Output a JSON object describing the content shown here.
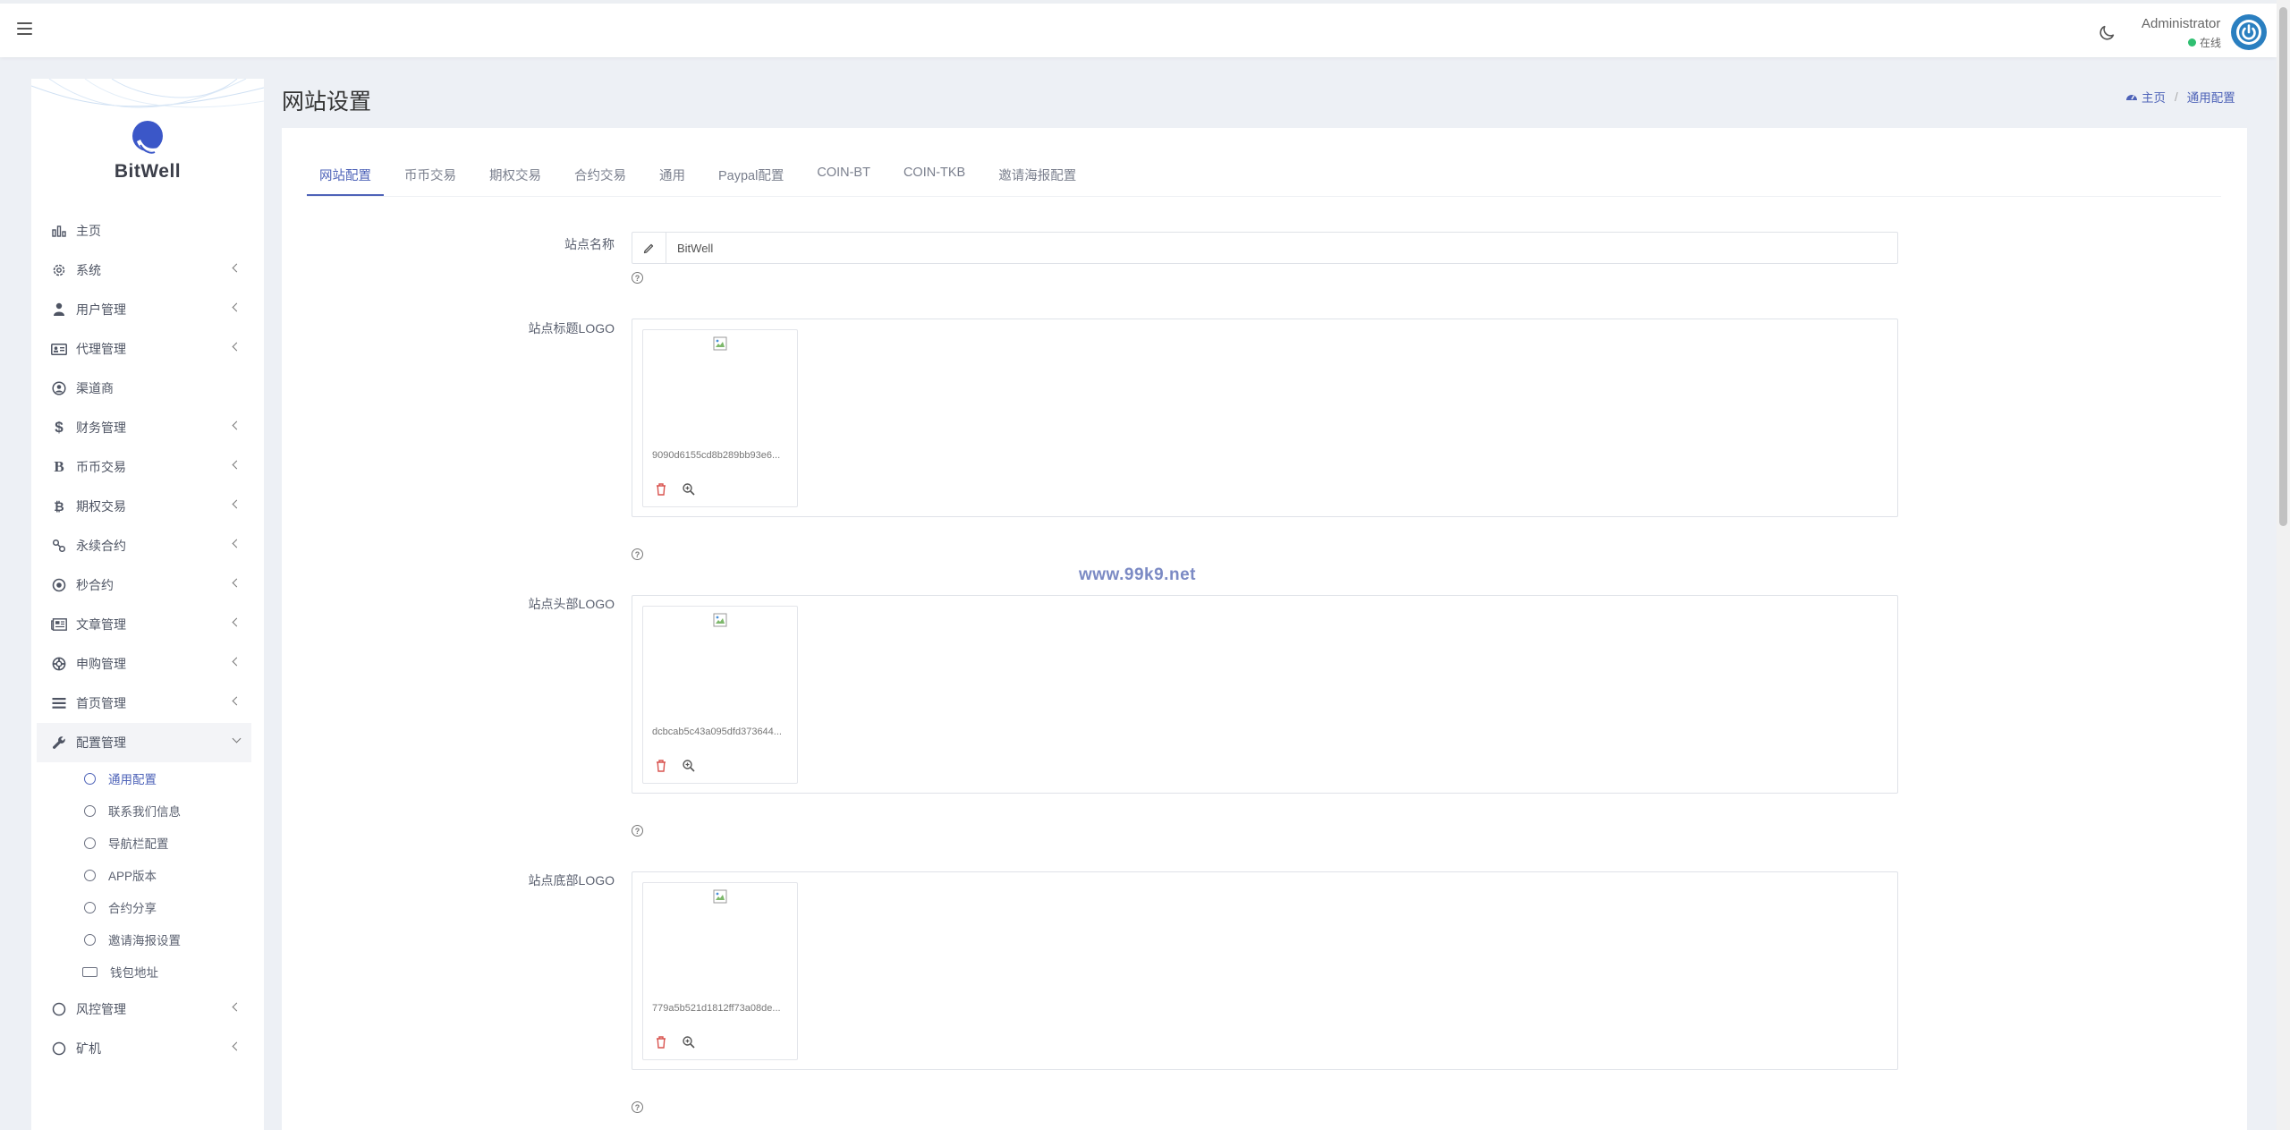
{
  "header": {
    "admin_name": "Administrator",
    "admin_status": "在线"
  },
  "sidebar": {
    "brand": "BitWell",
    "items": [
      {
        "label": "主页",
        "icon": "chart-bar-icon",
        "has_arrow": false
      },
      {
        "label": "系统",
        "icon": "gear-icon",
        "has_arrow": true
      },
      {
        "label": "用户管理",
        "icon": "user-tie-icon",
        "has_arrow": true
      },
      {
        "label": "代理管理",
        "icon": "id-card-icon",
        "has_arrow": true
      },
      {
        "label": "渠道商",
        "icon": "user-circle-icon",
        "has_arrow": false
      },
      {
        "label": "财务管理",
        "icon": "dollar-icon",
        "has_arrow": true
      },
      {
        "label": "币币交易",
        "icon": "bitcoin-b-icon",
        "has_arrow": true
      },
      {
        "label": "期权交易",
        "icon": "bitcoin-icon",
        "has_arrow": true
      },
      {
        "label": "永续合约",
        "icon": "link-icon",
        "has_arrow": true
      },
      {
        "label": "秒合约",
        "icon": "dot-circle-icon",
        "has_arrow": true
      },
      {
        "label": "文章管理",
        "icon": "newspaper-icon",
        "has_arrow": true
      },
      {
        "label": "申购管理",
        "icon": "life-ring-icon",
        "has_arrow": true
      },
      {
        "label": "首页管理",
        "icon": "list-icon",
        "has_arrow": true
      },
      {
        "label": "配置管理",
        "icon": "wrench-icon",
        "has_arrow": true
      }
    ],
    "sub_items": [
      {
        "label": "通用配置",
        "active": true
      },
      {
        "label": "联系我们信息",
        "active": false
      },
      {
        "label": "导航栏配置",
        "active": false
      },
      {
        "label": "APP版本",
        "active": false
      },
      {
        "label": "合约分享",
        "active": false
      },
      {
        "label": "邀请海报设置",
        "active": false
      },
      {
        "label": "钱包地址",
        "active": false
      }
    ],
    "after_items": [
      {
        "label": "风控管理",
        "icon": "circle-icon"
      },
      {
        "label": "矿机",
        "icon": "circle-icon"
      }
    ]
  },
  "page": {
    "title": "网站设置",
    "breadcrumb_home": "主页",
    "breadcrumb_current": "通用配置"
  },
  "tabs": [
    "网站配置",
    "币币交易",
    "期权交易",
    "合约交易",
    "通用",
    "Paypal配置",
    "COIN-BT",
    "COIN-TKB",
    "邀请海报配置"
  ],
  "form": {
    "site_name_label": "站点名称",
    "site_name_value": "BitWell",
    "title_logo_label": "站点标题LOGO",
    "title_logo_file": "9090d6155cd8b289bb93e6...",
    "header_logo_label": "站点头部LOGO",
    "header_logo_file": "dcbcab5c43a095dfd373644...",
    "footer_logo_label": "站点底部LOGO",
    "footer_logo_file": "779a5b521d1812ff73a08de..."
  },
  "watermark": "www.99k9.net",
  "colors": {
    "accent": "#4e63b8",
    "online": "#2fbf71",
    "background": "#edf0f5"
  }
}
